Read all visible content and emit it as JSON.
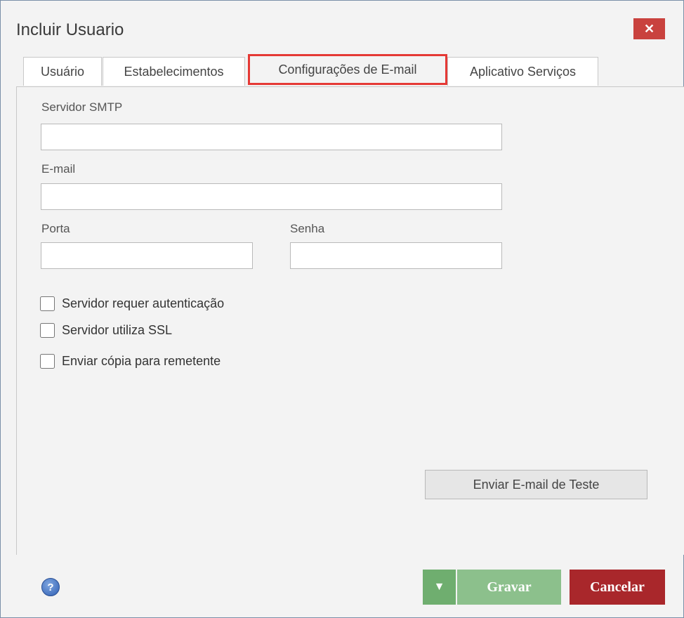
{
  "window": {
    "title": "Incluir Usuario",
    "close_label": "✕"
  },
  "tabs": [
    {
      "label": "Usuário",
      "active": false
    },
    {
      "label": "Estabelecimentos",
      "active": false
    },
    {
      "label": "Configurações de E-mail",
      "active": true
    },
    {
      "label": "Aplicativo Serviços",
      "active": false
    }
  ],
  "form": {
    "smtp_label": "Servidor SMTP",
    "smtp_value": "",
    "email_label": "E-mail",
    "email_value": "",
    "port_label": "Porta",
    "port_value": "",
    "password_label": "Senha",
    "password_value": ""
  },
  "checkboxes": [
    {
      "label": "Servidor requer autenticação",
      "checked": false
    },
    {
      "label": "Servidor utiliza SSL",
      "checked": false
    },
    {
      "label": "Enviar cópia para remetente",
      "checked": false
    }
  ],
  "test_button_label": "Enviar E-mail de Teste",
  "footer": {
    "help_icon": "?",
    "dropdown_arrow": "▼",
    "save_label": "Gravar",
    "cancel_label": "Cancelar"
  },
  "colors": {
    "highlight": "#e53935",
    "save": "#8cc08c",
    "cancel": "#a9272b",
    "close": "#c9423e"
  }
}
